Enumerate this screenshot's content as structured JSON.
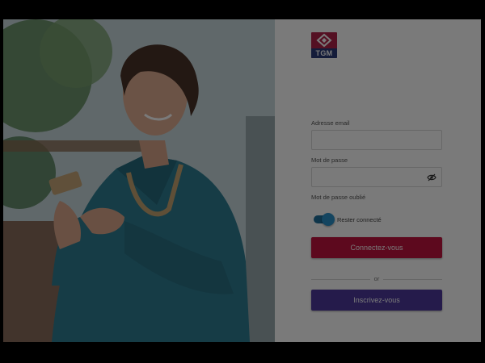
{
  "brand": {
    "logo_text": "TGM",
    "logo_color": "#b0234a",
    "logo_text_bg": "#2a3b7a"
  },
  "form": {
    "email_label": "Adresse email",
    "email_value": "",
    "password_label": "Mot de passe",
    "password_value": "",
    "password_icon": "eye-off-icon",
    "forgot_label": "Mot de passe oublié",
    "remember_label": "Rester connecté",
    "remember_checked": true,
    "login_button": "Connectez-vous",
    "or_label": "or",
    "signup_button": "Inscrivez-vous"
  },
  "colors": {
    "login_button": "#c2143f",
    "signup_button": "#4e3a9e",
    "toggle": "#2a90c8",
    "backdrop": "rgba(0,0,0,0.52)"
  }
}
